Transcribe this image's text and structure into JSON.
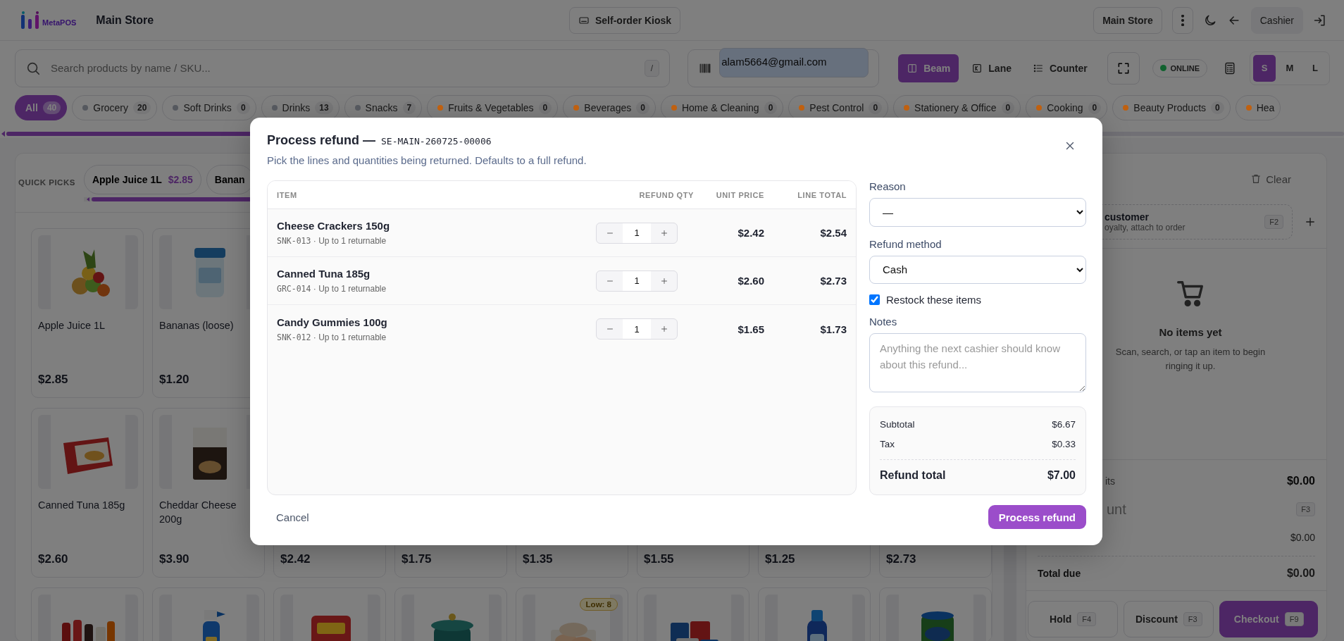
{
  "header": {
    "logo_text": "MetaPOS",
    "store_title": "Main Store",
    "kiosk_button": "Self-order Kiosk",
    "store_button": "Main Store",
    "user_button": "Cashier"
  },
  "toolbar": {
    "search": {
      "placeholder": "Search products by name / SKU...",
      "shortcut": "/"
    },
    "scan_field": {
      "value": "alam5664@gmail.com",
      "text_selected": true
    },
    "modes": [
      {
        "label": "Beam",
        "selected": true
      },
      {
        "label": "Lane",
        "selected": false
      },
      {
        "label": "Counter",
        "selected": false
      }
    ],
    "status": "ONLINE",
    "sizes": [
      {
        "label": "S",
        "selected": true
      },
      {
        "label": "M",
        "selected": false
      },
      {
        "label": "L",
        "selected": false
      }
    ]
  },
  "categories": [
    {
      "label": "All",
      "count": "40",
      "selected": true
    },
    {
      "label": "Grocery",
      "count": "20",
      "selected": false,
      "color": "#55585e"
    },
    {
      "label": "Soft Drinks",
      "count": "0",
      "selected": false,
      "color": "#55585e"
    },
    {
      "label": "Drinks",
      "count": "13",
      "selected": false,
      "color": "#55585e"
    },
    {
      "label": "Snacks",
      "count": "7",
      "selected": false,
      "color": "#55585e"
    },
    {
      "label": "Fruits & Vegetables",
      "count": "0",
      "selected": false,
      "color": "#c0600f"
    },
    {
      "label": "Beverages",
      "count": "0",
      "selected": false,
      "color": "#c0600f"
    },
    {
      "label": "Home & Cleaning",
      "count": "0",
      "selected": false,
      "color": "#c0600f"
    },
    {
      "label": "Pest Control",
      "count": "0",
      "selected": false,
      "color": "#c0600f"
    },
    {
      "label": "Stationery & Office",
      "count": "0",
      "selected": false,
      "color": "#c0600f"
    },
    {
      "label": "Cooking",
      "count": "0",
      "selected": false,
      "color": "#c0600f"
    },
    {
      "label": "Beauty Products",
      "count": "0",
      "selected": false,
      "color": "#c0600f"
    },
    {
      "label": "Hea",
      "selected": false,
      "color": "#c0600f"
    }
  ],
  "quick_picks": {
    "label": "QUICK PICKS",
    "items": [
      {
        "name": "Apple Juice 1L",
        "price": "$2.85"
      },
      {
        "name": "Banan"
      }
    ]
  },
  "product_rows": [
    {
      "cards": [
        {
          "kind": "picture",
          "name": "Apple Juice 1L",
          "price": "$2.85"
        },
        {
          "kind": "picture",
          "name": "Bananas (loose)",
          "price": "$1.20"
        }
      ]
    },
    {
      "cards": [
        {
          "kind": "picture",
          "name": "Canned Tuna 185g",
          "price": "$2.60"
        },
        {
          "kind": "picture",
          "name": "Cheddar Cheese 200g",
          "price": "$3.90"
        },
        {
          "price": "$2.42"
        },
        {
          "price": "$1.75"
        },
        {
          "price": "$1.35"
        },
        {
          "price": "$1.55"
        },
        {
          "price": "$1.25"
        },
        {
          "price": "$2.73"
        }
      ]
    },
    {
      "cards": [
        {
          "kind": "picture"
        },
        {
          "kind": "picture"
        },
        {
          "kind": "picture"
        },
        {
          "kind": "picture"
        },
        {
          "kind": "picture",
          "badge": "Low: 8"
        },
        {
          "kind": "picture"
        },
        {
          "kind": "picture"
        },
        {
          "kind": "picture"
        }
      ]
    }
  ],
  "cart": {
    "clear_button": "Clear",
    "customer": {
      "title": "customer",
      "hint": "oyalty, attach to order",
      "shortcut": "F2"
    },
    "empty": {
      "title": "No items yet",
      "text": "Scan, search, or tap an item to begin ringing it up."
    },
    "totals": [
      {
        "kind": "line",
        "label": "its",
        "value": "$0.00",
        "bold": true
      },
      {
        "kind": "action",
        "label": "unt",
        "shortcut": "F3"
      },
      {
        "kind": "line",
        "value": "$0.00",
        "bold": false
      },
      {
        "kind": "total",
        "label": "Total due",
        "value": "$0.00"
      }
    ],
    "actions": [
      {
        "kind": "plain",
        "label": "Hold",
        "shortcut": "F4"
      },
      {
        "kind": "plain",
        "label": "Discount",
        "shortcut": "F3"
      },
      {
        "kind": "primary",
        "label": "Checkout",
        "shortcut": "F9"
      }
    ]
  },
  "refund_dialog": {
    "title": "Process refund —",
    "receipt": "SE-MAIN-260725-00006",
    "subtitle": "Pick the lines and quantities being returned. Defaults to a full refund.",
    "columns": [
      "ITEM",
      "REFUND QTY",
      "UNIT PRICE",
      "LINE TOTAL"
    ],
    "lines": [
      {
        "name": "Cheese Crackers 150g",
        "sku": "SNK-013",
        "note": "· Up to 1 returnable",
        "qty": "1",
        "unit_price": "$2.42",
        "line_total": "$2.54"
      },
      {
        "name": "Canned Tuna 185g",
        "sku": "GRC-014",
        "note": "· Up to 1 returnable",
        "qty": "1",
        "unit_price": "$2.60",
        "line_total": "$2.73"
      },
      {
        "name": "Candy Gummies 100g",
        "sku": "SNK-012",
        "note": "· Up to 1 returnable",
        "qty": "1",
        "unit_price": "$1.65",
        "line_total": "$1.73"
      }
    ],
    "reason": {
      "label": "Reason",
      "value": "—"
    },
    "method": {
      "label": "Refund method",
      "value": "Cash"
    },
    "restock": {
      "label": "Restock these items",
      "checked": true
    },
    "notes": {
      "label": "Notes",
      "placeholder": "Anything the next cashier should know about this refund..."
    },
    "summary": [
      {
        "kind": "line",
        "label": "Subtotal",
        "value": "$6.67"
      },
      {
        "kind": "line",
        "label": "Tax",
        "value": "$0.33"
      },
      {
        "kind": "total",
        "label": "Refund total",
        "value": "$7.00"
      }
    ],
    "cancel": "Cancel",
    "submit": "Process refund"
  }
}
